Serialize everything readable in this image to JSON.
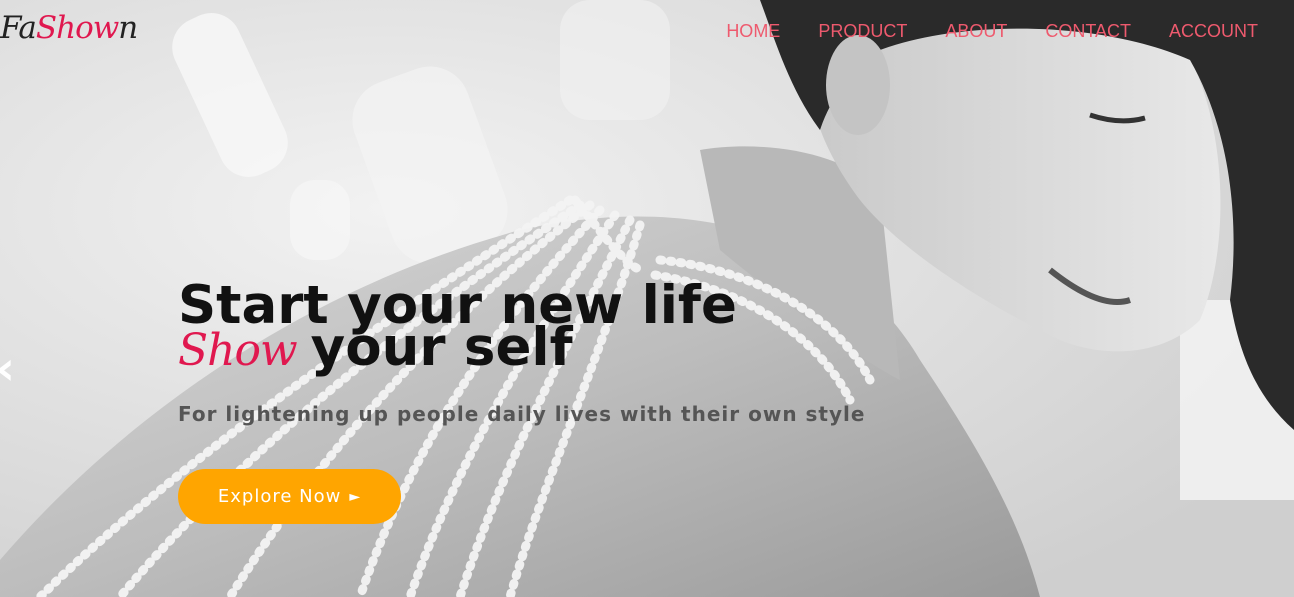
{
  "brand": {
    "logo_part1": "Fa",
    "logo_part2": "Show",
    "logo_part3": "n"
  },
  "nav": {
    "items": [
      {
        "label": "HOME"
      },
      {
        "label": "PRODUCT"
      },
      {
        "label": "ABOUT"
      },
      {
        "label": "CONTACT"
      },
      {
        "label": "ACCOUNT"
      }
    ]
  },
  "slider": {
    "prev_icon": "‹",
    "prev_icon_name": "chevron-left-icon"
  },
  "hero": {
    "headline": "Start your new life",
    "sub_accent": "Show",
    "sub_rest": "your self",
    "tagline": "For lightening up people daily lives with their own style",
    "cta_label": "Explore Now",
    "cta_icon": "►",
    "cta_icon_name": "play-arrow-icon"
  },
  "colors": {
    "accent": "#e0184f",
    "nav_text": "#ee5a6e",
    "button": "#ffa500",
    "headline": "#111111",
    "tagline": "#555555"
  }
}
